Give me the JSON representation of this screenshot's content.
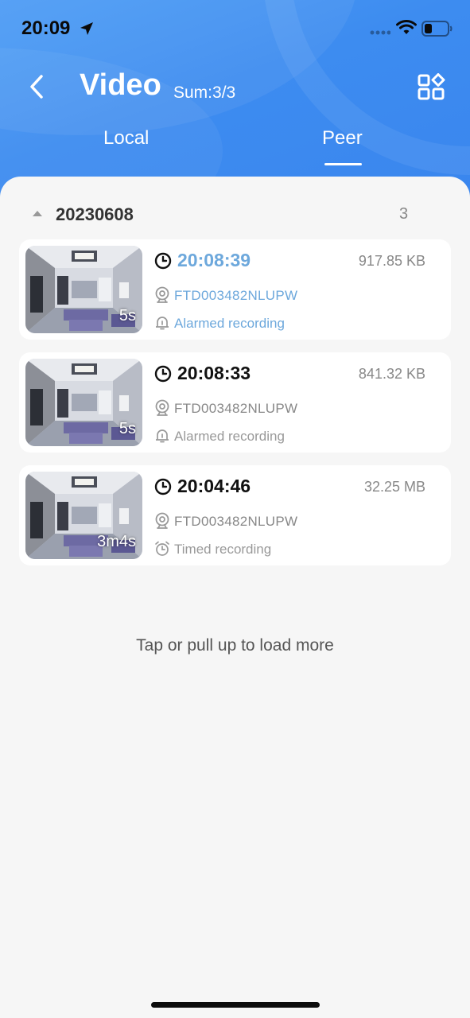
{
  "status_bar": {
    "time": "20:09"
  },
  "header": {
    "title": "Video",
    "sum": "Sum:3/3",
    "tabs": [
      {
        "label": "Local",
        "active": false
      },
      {
        "label": "Peer",
        "active": true
      }
    ]
  },
  "group": {
    "date": "20230608",
    "count": "3"
  },
  "recordings": [
    {
      "duration": "5s",
      "time": "20:08:39",
      "size": "917.85 KB",
      "device": "FTD003482NLUPW",
      "type": "Alarmed recording",
      "type_icon": "bell-icon",
      "selected": true
    },
    {
      "duration": "5s",
      "time": "20:08:33",
      "size": "841.32 KB",
      "device": "FTD003482NLUPW",
      "type": "Alarmed recording",
      "type_icon": "bell-icon",
      "selected": false
    },
    {
      "duration": "3m4s",
      "time": "20:04:46",
      "size": "32.25 MB",
      "device": "FTD003482NLUPW",
      "type": "Timed recording",
      "type_icon": "alarm-clock-icon",
      "selected": false
    }
  ],
  "load_more": "Tap or pull up to load more",
  "colors": {
    "header": "#3d8cf0",
    "accent": "#6da8dc",
    "background": "#f6f6f6"
  }
}
